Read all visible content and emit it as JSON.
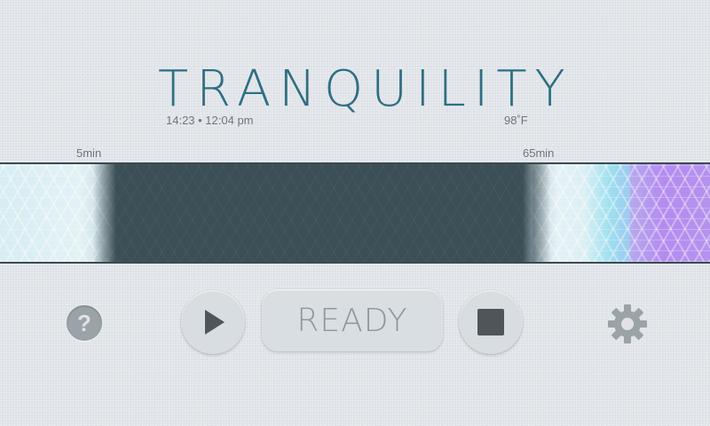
{
  "app": {
    "title": "TRANQUILITY",
    "time_info": "14:23 • 12:04 pm",
    "temperature": "98˚F"
  },
  "timeline": {
    "start_label": "5min",
    "end_label": "65min",
    "colors": {
      "pale": "#d6edf2",
      "dark": "#3c4f56",
      "cyan": "#9fe0ef",
      "purple": "#b48cf0"
    }
  },
  "controls": {
    "help_icon": "question-icon",
    "play_icon": "play-icon",
    "status_label": "READY",
    "stop_icon": "stop-icon",
    "settings_icon": "gear-icon"
  }
}
